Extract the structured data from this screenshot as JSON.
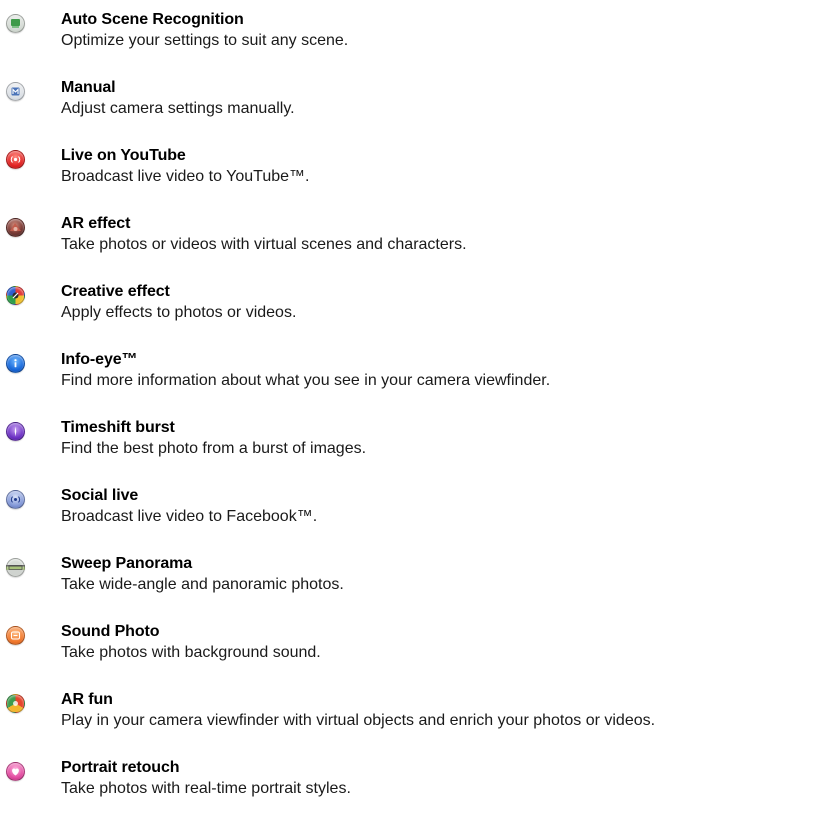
{
  "modes": [
    {
      "title": "Auto Scene Recognition",
      "description": "Optimize your settings to suit any scene.",
      "icon": "auto-scene-icon",
      "color": "#c8d0c8"
    },
    {
      "title": "Manual",
      "description": "Adjust camera settings manually.",
      "icon": "manual-icon",
      "color": "#d0d6de"
    },
    {
      "title": "Live on YouTube",
      "description": "Broadcast live video to YouTube™.",
      "icon": "live-broadcast-icon",
      "color": "#e02020"
    },
    {
      "title": "AR effect",
      "description": "Take photos or videos with virtual scenes and characters.",
      "icon": "ar-effect-icon",
      "color": "#7a3a35"
    },
    {
      "title": "Creative effect",
      "description": "Apply effects to photos or videos.",
      "icon": "creative-effect-icon",
      "color": "#2f5fd0"
    },
    {
      "title": "Info-eye™",
      "description": "Find more information about what you see in your camera viewfinder.",
      "icon": "info-icon",
      "color": "#1565d8"
    },
    {
      "title": "Timeshift burst",
      "description": "Find the best photo from a burst of images.",
      "icon": "timeshift-burst-icon",
      "color": "#6a2ec2"
    },
    {
      "title": "Social live",
      "description": "Broadcast live video to Facebook™.",
      "icon": "social-live-icon",
      "color": "#7f95d6"
    },
    {
      "title": "Sweep Panorama",
      "description": "Take wide-angle and panoramic photos.",
      "icon": "sweep-panorama-icon",
      "color": "#a7c27a"
    },
    {
      "title": "Sound Photo",
      "description": "Take photos with background sound.",
      "icon": "sound-photo-icon",
      "color": "#f0762a"
    },
    {
      "title": "AR fun",
      "description": "Play in your camera viewfinder with virtual objects and enrich your photos or videos.",
      "icon": "ar-fun-icon",
      "color": "#e6462d"
    },
    {
      "title": "Portrait retouch",
      "description": "Take photos with real-time portrait styles.",
      "icon": "portrait-retouch-icon",
      "color": "#e0479d"
    }
  ]
}
